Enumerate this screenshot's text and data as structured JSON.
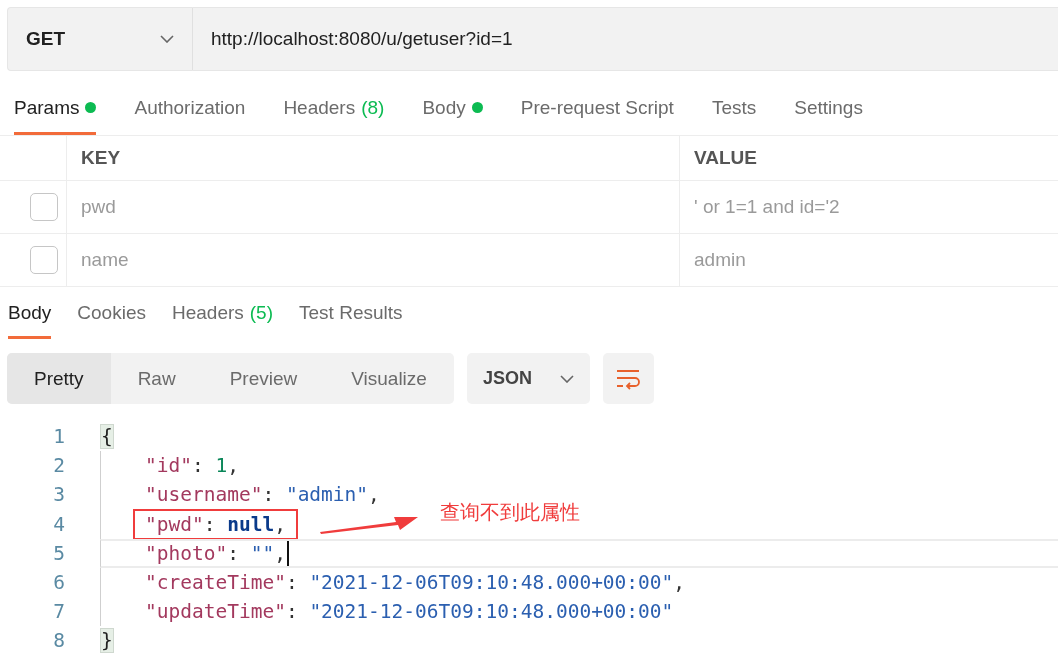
{
  "request": {
    "method": "GET",
    "url": "http://localhost:8080/u/getuser?id=1"
  },
  "request_tabs": [
    {
      "label": "Params",
      "dot": true,
      "selected": true
    },
    {
      "label": "Authorization",
      "dot": false,
      "selected": false
    },
    {
      "label": "Headers",
      "count": "(8)",
      "dot": false,
      "selected": false
    },
    {
      "label": "Body",
      "dot": true,
      "selected": false
    },
    {
      "label": "Pre-request Script",
      "dot": false,
      "selected": false
    },
    {
      "label": "Tests",
      "dot": false,
      "selected": false
    },
    {
      "label": "Settings",
      "dot": false,
      "selected": false
    }
  ],
  "params": {
    "columns": [
      "KEY",
      "VALUE"
    ],
    "rows": [
      {
        "key": "pwd",
        "value": "' or 1=1 and id='2",
        "checked": false
      },
      {
        "key": "name",
        "value": "admin",
        "checked": false
      }
    ]
  },
  "response_tabs": [
    {
      "label": "Body",
      "selected": true
    },
    {
      "label": "Cookies",
      "selected": false
    },
    {
      "label": "Headers",
      "count": "(5)",
      "selected": false
    },
    {
      "label": "Test Results",
      "selected": false
    }
  ],
  "view_modes": [
    {
      "label": "Pretty",
      "selected": true
    },
    {
      "label": "Raw",
      "selected": false
    },
    {
      "label": "Preview",
      "selected": false
    },
    {
      "label": "Visualize",
      "selected": false
    }
  ],
  "format": "JSON",
  "code": [
    {
      "number": "1",
      "boxed": false,
      "current": false,
      "tokens": [
        {
          "kind": "brace",
          "text": "{"
        }
      ]
    },
    {
      "number": "2",
      "boxed": false,
      "current": false,
      "tokens": [
        {
          "kind": "key",
          "text": "\"id\""
        },
        {
          "kind": "punct",
          "text": ": "
        },
        {
          "kind": "number",
          "text": "1"
        },
        {
          "kind": "punct",
          "text": ","
        }
      ]
    },
    {
      "number": "3",
      "boxed": false,
      "current": false,
      "tokens": [
        {
          "kind": "key",
          "text": "\"username\""
        },
        {
          "kind": "punct",
          "text": ": "
        },
        {
          "kind": "string",
          "text": "\"admin\""
        },
        {
          "kind": "punct",
          "text": ","
        }
      ]
    },
    {
      "number": "4",
      "boxed": true,
      "current": false,
      "tokens": [
        {
          "kind": "key",
          "text": "\"pwd\""
        },
        {
          "kind": "punct",
          "text": ": "
        },
        {
          "kind": "keyword",
          "text": "null"
        },
        {
          "kind": "punct",
          "text": ","
        }
      ]
    },
    {
      "number": "5",
      "boxed": false,
      "current": true,
      "tokens": [
        {
          "kind": "key",
          "text": "\"photo\""
        },
        {
          "kind": "punct",
          "text": ": "
        },
        {
          "kind": "string",
          "text": "\"\""
        },
        {
          "kind": "punct",
          "text": ","
        }
      ]
    },
    {
      "number": "6",
      "boxed": false,
      "current": false,
      "tokens": [
        {
          "kind": "key",
          "text": "\"createTime\""
        },
        {
          "kind": "punct",
          "text": ": "
        },
        {
          "kind": "string",
          "text": "\"2021-12-06T09:10:48.000+00:00\""
        },
        {
          "kind": "punct",
          "text": ","
        }
      ]
    },
    {
      "number": "7",
      "boxed": false,
      "current": false,
      "tokens": [
        {
          "kind": "key",
          "text": "\"updateTime\""
        },
        {
          "kind": "punct",
          "text": ": "
        },
        {
          "kind": "string",
          "text": "\"2021-12-06T09:10:48.000+00:00\""
        }
      ]
    },
    {
      "number": "8",
      "boxed": false,
      "current": false,
      "tokens": [
        {
          "kind": "brace",
          "text": "}"
        }
      ]
    }
  ],
  "annotation": {
    "note": "查询不到此属性"
  }
}
